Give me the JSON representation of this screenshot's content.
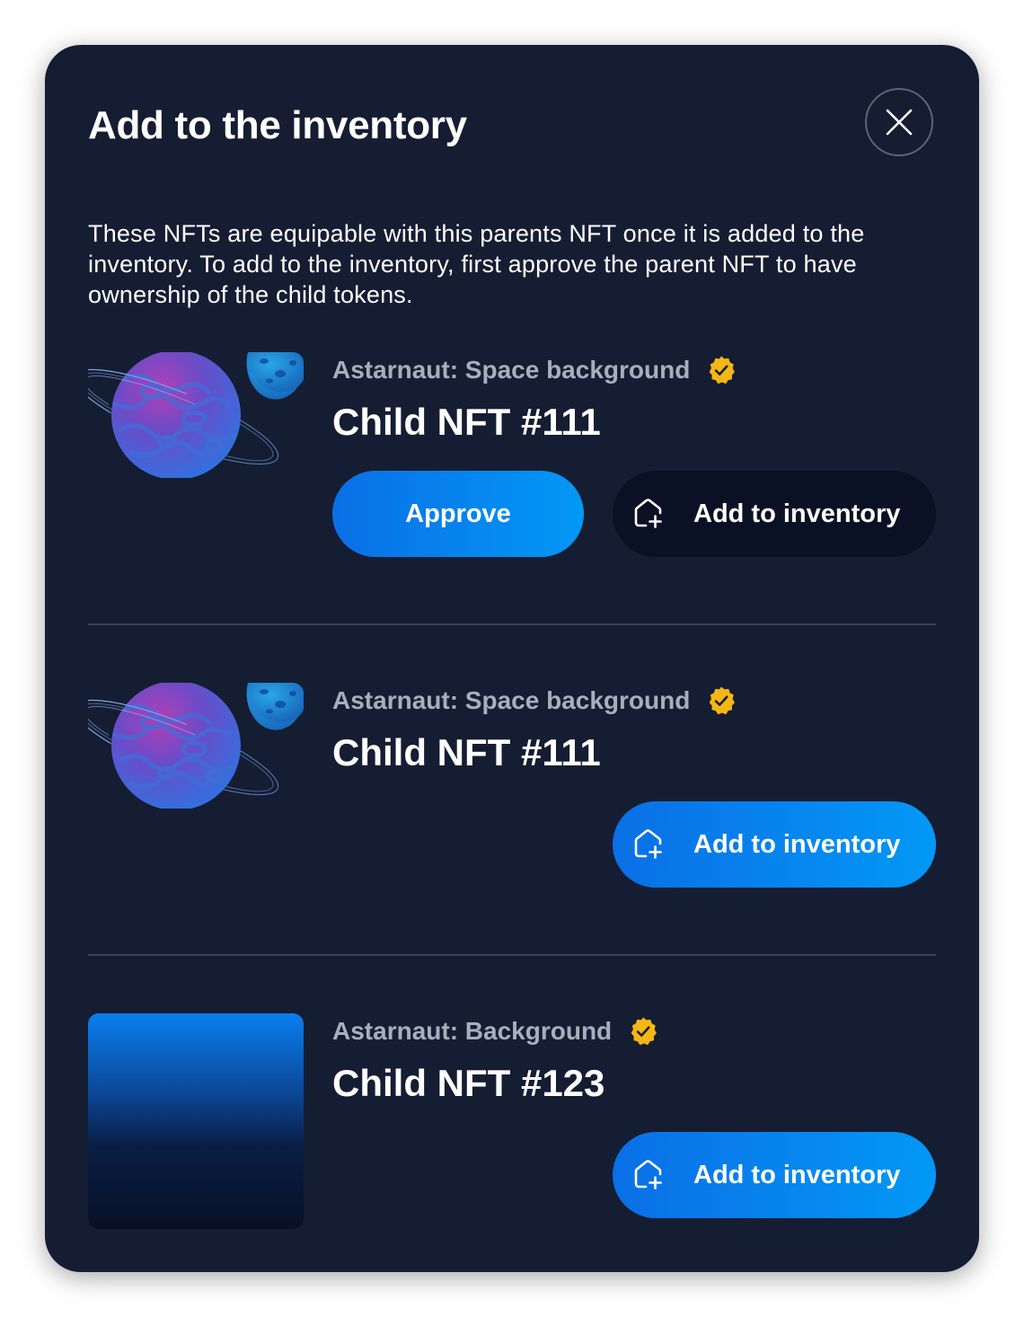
{
  "modal": {
    "title": "Add to the inventory",
    "description": "These NFTs are equipable with this parents NFT  once it is added to the inventory. To add to the inventory, first approve the parent NFT to have ownership of the child tokens.",
    "close_icon": "close-icon"
  },
  "items": [
    {
      "collection": "Astarnaut: Space background",
      "name": "Child NFT #111",
      "image": "planet",
      "verified": true,
      "approve_label": "Approve",
      "add_label": "Add to inventory",
      "add_enabled": false
    },
    {
      "collection": "Astarnaut: Space background",
      "name": "Child NFT #111",
      "image": "planet",
      "verified": true,
      "add_label": "Add to inventory",
      "add_enabled": true
    },
    {
      "collection": "Astarnaut: Background",
      "name": "Child NFT #123",
      "image": "blue-gradient",
      "verified": true,
      "add_label": "Add to inventory",
      "add_enabled": true
    }
  ],
  "colors": {
    "modal_bg": "#151d33",
    "accent_blue": "#0a6fe6",
    "accent_blue_light": "#0398f5",
    "dark_button": "#0b1124",
    "verified_badge": "#f5b714",
    "divider": "#3b4356",
    "muted_text": "#a8aebb"
  }
}
